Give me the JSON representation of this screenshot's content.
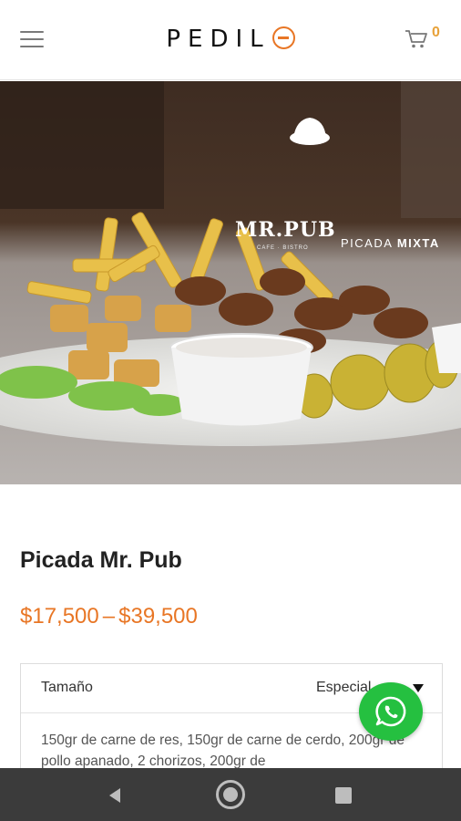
{
  "header": {
    "logo_text": "PEDIL",
    "cart_count": "0"
  },
  "hero": {
    "brand_name": "MR.PUB",
    "brand_sub": "CAFE · BISTRO",
    "tag_prefix": "PICADA",
    "tag_bold": "MIXTA"
  },
  "product": {
    "title": "Picada Mr. Pub",
    "price_min": "$17,500",
    "price_sep": "–",
    "price_max": "$39,500"
  },
  "options": {
    "label": "Tamaño",
    "selected": "Especial",
    "description": "150gr de carne de res, 150gr de carne de cerdo, 200gr de pollo apanado, 2 chorizos, 200gr de"
  },
  "colors": {
    "accent": "#e87625",
    "whatsapp": "#25c040",
    "navbar": "#3b3b3b"
  },
  "icons": [
    "menu-icon",
    "cart-icon",
    "whatsapp-icon",
    "back-icon",
    "home-icon",
    "recents-icon"
  ]
}
